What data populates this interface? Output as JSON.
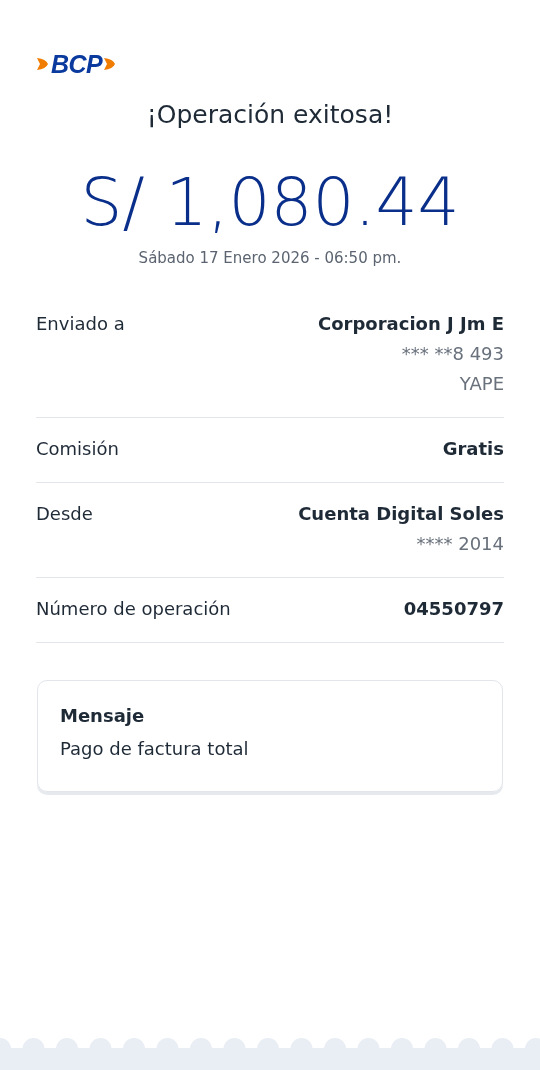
{
  "logo": {
    "text": "BCP"
  },
  "title": "¡Operación exitosa!",
  "amount": "S/ 1,080.44",
  "date": "Sábado 17 Enero 2026 - 06:50 pm.",
  "details": [
    {
      "label": "Enviado a",
      "values": [
        {
          "text": "Corporacion J Jm E",
          "kind": "primary"
        },
        {
          "text": "*** **8 493",
          "kind": "secondary"
        },
        {
          "text": "YAPE",
          "kind": "secondary"
        }
      ]
    },
    {
      "label": "Comisión",
      "values": [
        {
          "text": "Gratis",
          "kind": "primary"
        }
      ]
    },
    {
      "label": "Desde",
      "values": [
        {
          "text": "Cuenta Digital Soles",
          "kind": "primary"
        },
        {
          "text": "**** 2014",
          "kind": "secondary"
        }
      ]
    },
    {
      "label": "Número de operación",
      "values": [
        {
          "text": "04550797",
          "kind": "primary"
        }
      ]
    }
  ],
  "message": {
    "title": "Mensaje",
    "text": "Pago de factura total"
  }
}
